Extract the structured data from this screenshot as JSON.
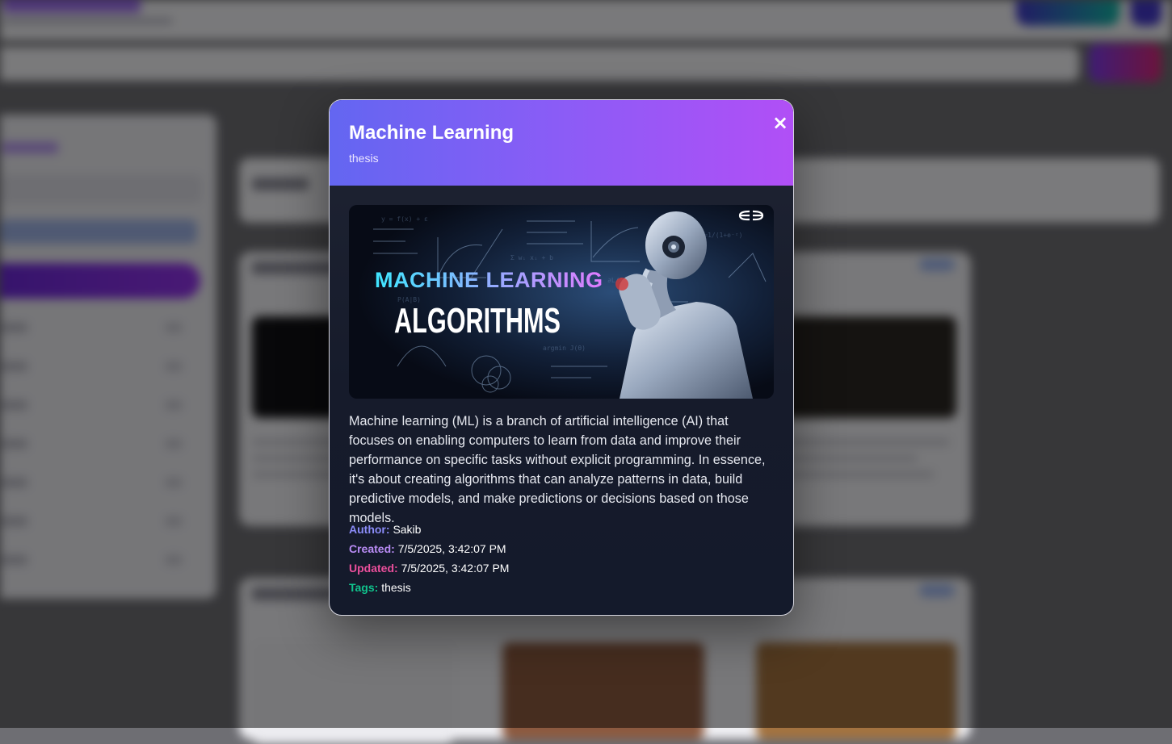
{
  "modal": {
    "title": "Machine Learning",
    "subtitle": "thesis",
    "close_icon": "×",
    "image": {
      "headline": "MACHINE LEARNING",
      "subheadline": "ALGORITHMS",
      "logo": "gfg-logo"
    },
    "description": "Machine learning (ML) is a branch of artificial intelligence (AI) that focuses on enabling computers to learn from data and improve their performance on specific tasks without explicit programming. In essence, it's about creating algorithms that can analyze patterns in data, build predictive models, and make predictions or decisions based on those models.",
    "meta": {
      "author_label": "Author:",
      "author": "Sakib",
      "created_label": "Created:",
      "created": "7/5/2025, 3:42:07 PM",
      "updated_label": "Updated:",
      "updated": "7/5/2025, 3:42:07 PM",
      "tags_label": "Tags:",
      "tags": "thesis"
    }
  },
  "colors": {
    "header_gradient_start": "#6366f1",
    "header_gradient_end": "#b14ff6",
    "author_label": "#8b8cf8",
    "created_label": "#b98cf5",
    "updated_label": "#ec4f9c",
    "tags_label": "#10c38d"
  }
}
